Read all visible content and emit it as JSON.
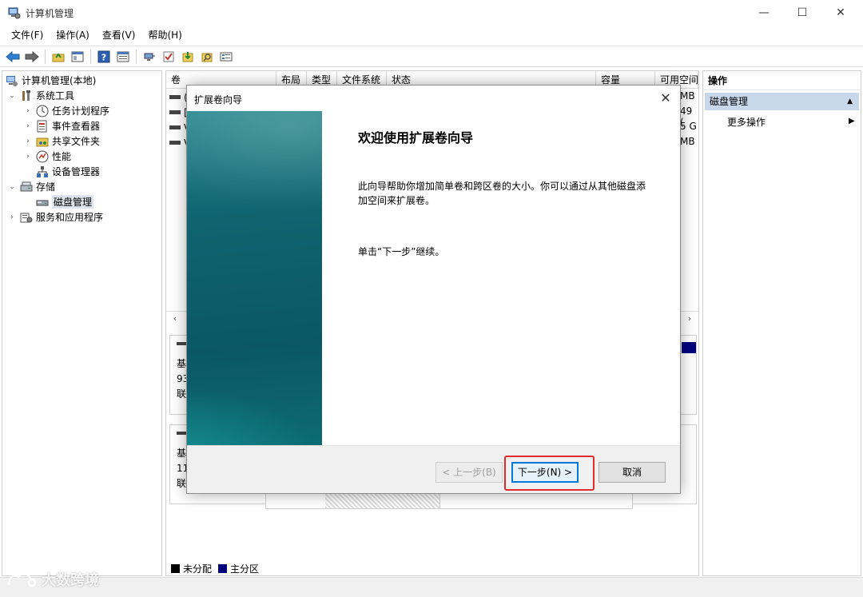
{
  "window": {
    "title": "计算机管理",
    "controls": {
      "minimize": "—",
      "maximize": "☐",
      "close": "✕"
    }
  },
  "menu": [
    "文件(F)",
    "操作(A)",
    "查看(V)",
    "帮助(H)"
  ],
  "tree": {
    "root": "计算机管理(本地)",
    "system_tools": "系统工具",
    "task_scheduler": "任务计划程序",
    "event_viewer": "事件查看器",
    "shared_folders": "共享文件夹",
    "performance": "性能",
    "device_manager": "设备管理器",
    "storage": "存储",
    "disk_management": "磁盘管理",
    "services_apps": "服务和应用程序"
  },
  "columns": [
    "卷",
    "布局",
    "类型",
    "文件系统",
    "状态",
    "容量",
    "可用空间"
  ],
  "volumes": [
    {
      "name": "(",
      "free": "MB"
    },
    {
      "name": "[",
      "free": "49 ("
    },
    {
      "name": "V",
      "free": "5 G"
    },
    {
      "name": "V",
      "free": "MB"
    }
  ],
  "disks": [
    {
      "line1": "基",
      "line2": "93",
      "line3": "联"
    },
    {
      "line1": "基",
      "line2": "11",
      "line3": "联"
    }
  ],
  "legend": {
    "unallocated": "未分配",
    "primary": "主分区"
  },
  "colors": {
    "unallocated": "#000000",
    "primary": "#00007f",
    "accent": "#0078d7",
    "highlight": "#e12a2a"
  },
  "actions": {
    "header": "操作",
    "section": "磁盘管理",
    "more": "更多操作"
  },
  "wizard": {
    "title": "扩展卷向导",
    "heading": "欢迎使用扩展卷向导",
    "description": "此向导帮助你增加简单卷和跨区卷的大小。你可以通过从其他磁盘添加空间来扩展卷。",
    "hint": "单击“下一步”继续。",
    "back_button": "< 上一步(B)",
    "next_button": "下一步(N) >",
    "cancel_button": "取消",
    "close": "✕"
  },
  "watermark": "大数跨境"
}
